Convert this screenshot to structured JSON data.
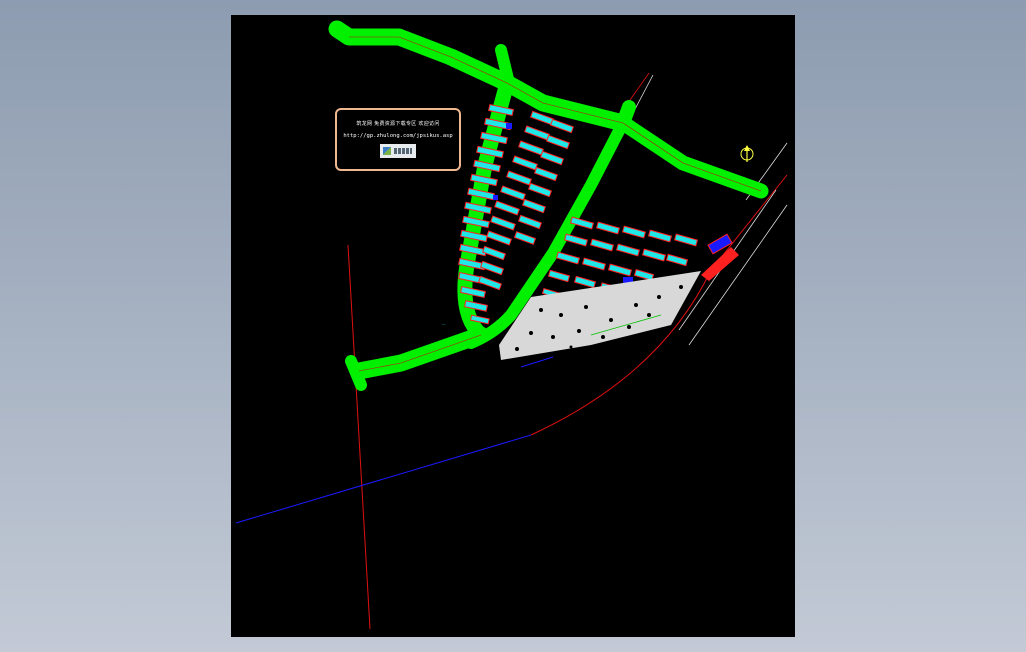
{
  "watermark": {
    "title": "筑龙网 免费资源下载专区 欢迎访问",
    "url": "http://gp.zhulong.com/jpsikus.asp",
    "logo": "zhulong-logo"
  },
  "colors": {
    "background": "#000000",
    "road": "#00f000",
    "building_outline": "#ff2020",
    "building_fill": "#20e8e8",
    "boundary_red": "#e01010",
    "boundary_blue": "#1a1aff",
    "terrain": "#d8d8d8",
    "workspace": "#8d9cb0"
  },
  "icons": {
    "north_arrow": "north-arrow-icon"
  }
}
